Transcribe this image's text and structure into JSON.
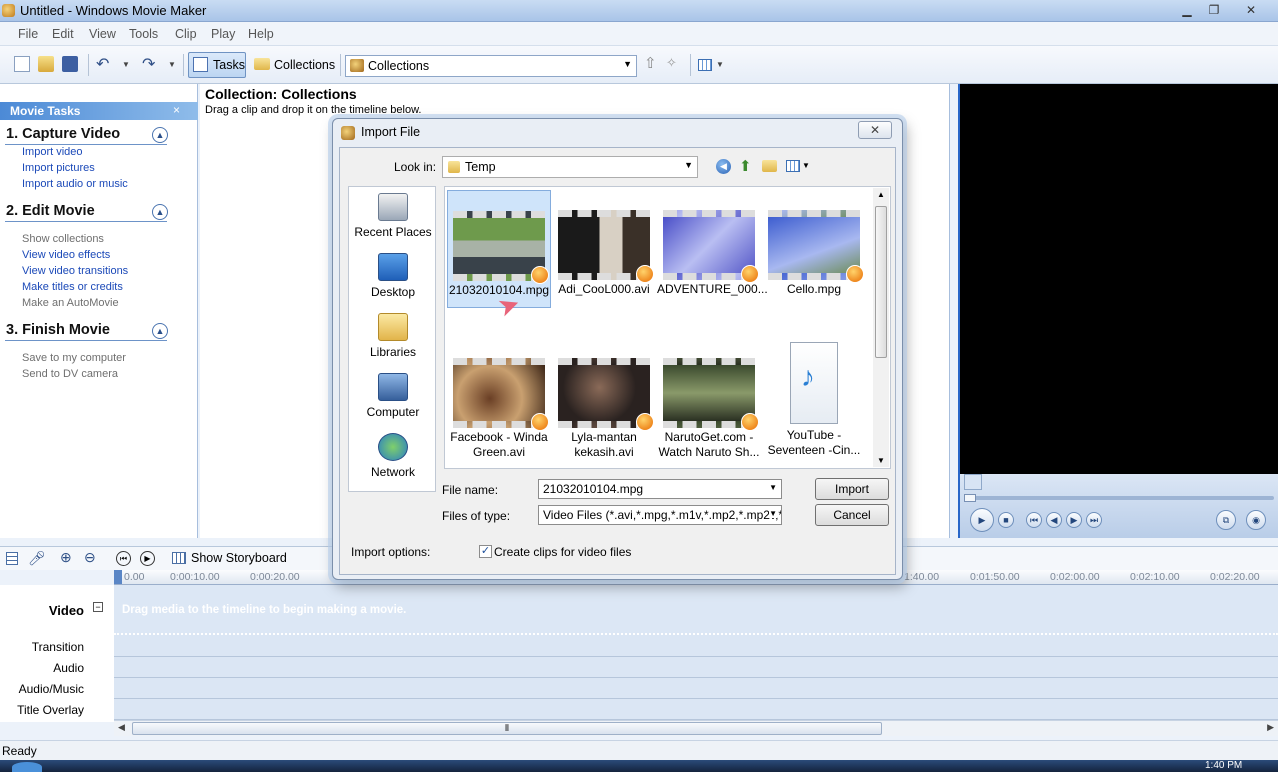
{
  "window": {
    "title": "Untitled - Windows Movie Maker",
    "min_icon": "minimize-icon",
    "max_icon": "maximize-icon",
    "close_icon": "close-icon"
  },
  "menu": [
    "File",
    "Edit",
    "View",
    "Tools",
    "Clip",
    "Play",
    "Help"
  ],
  "toolbar": {
    "tasks_label": "Tasks",
    "collections_label": "Collections",
    "collection_combo": "Collections"
  },
  "tasks_pane": {
    "header": "Movie Tasks",
    "close": "×",
    "sections": [
      {
        "title": "1. Capture Video",
        "items": [
          {
            "label": "Import video",
            "enabled": true
          },
          {
            "label": "Import pictures",
            "enabled": true
          },
          {
            "label": "Import audio or music",
            "enabled": true
          }
        ]
      },
      {
        "title": "2. Edit Movie",
        "items": [
          {
            "label": "Show collections",
            "enabled": false
          },
          {
            "label": "View video effects",
            "enabled": true
          },
          {
            "label": "View video transitions",
            "enabled": true
          },
          {
            "label": "Make titles or credits",
            "enabled": true
          },
          {
            "label": "Make an AutoMovie",
            "enabled": false
          }
        ]
      },
      {
        "title": "3. Finish Movie",
        "items": [
          {
            "label": "Save to my computer",
            "enabled": false
          },
          {
            "label": "Send to DV camera",
            "enabled": false
          }
        ]
      }
    ]
  },
  "collection": {
    "title": "Collection: Collections",
    "subtitle": "Drag a clip and drop it on the timeline below."
  },
  "dialog": {
    "title": "Import File",
    "close": "✕",
    "look_in_label": "Look in:",
    "look_in_value": "Temp",
    "places": [
      "Recent Places",
      "Desktop",
      "Libraries",
      "Computer",
      "Network"
    ],
    "files": [
      {
        "name": "21032010104.mpg",
        "line2": ""
      },
      {
        "name": "Adi_CooL000.avi",
        "line2": ""
      },
      {
        "name": "ADVENTURE_000...",
        "line2": ""
      },
      {
        "name": "Cello.mpg",
        "line2": ""
      },
      {
        "name": "Facebook - Winda",
        "line2": "Green.avi"
      },
      {
        "name": "Lyla-mantan",
        "line2": "kekasih.avi"
      },
      {
        "name": "NarutoGet.com -",
        "line2": "Watch Naruto Sh..."
      },
      {
        "name": "YouTube -",
        "line2": "Seventeen -Cin..."
      }
    ],
    "file_name_label": "File name:",
    "file_name_value": "21032010104.mpg",
    "file_type_label": "Files of type:",
    "file_type_value": "Video Files (*.avi,*.mpg,*.m1v,*.mp2,*.mp2v,*.m",
    "import_button": "Import",
    "cancel_button": "Cancel",
    "import_options_label": "Import options:",
    "create_clips_label": "Create clips for video files",
    "create_clips_checked": true
  },
  "timeline": {
    "storyboard_label": "Show Storyboard",
    "ticks": [
      "0.00",
      "0:00:10.00",
      "0:00:20.00",
      "1:40.00",
      "0:01:50.00",
      "0:02:00.00",
      "0:02:10.00",
      "0:02:20.00"
    ],
    "tracks": [
      "Video",
      "Transition",
      "Audio",
      "Audio/Music",
      "Title Overlay"
    ],
    "hint": "Drag media to the timeline to begin making a movie.",
    "scroll_grip": "⦀"
  },
  "status": "Ready",
  "taskbar": {
    "clock": "1:40 PM"
  }
}
